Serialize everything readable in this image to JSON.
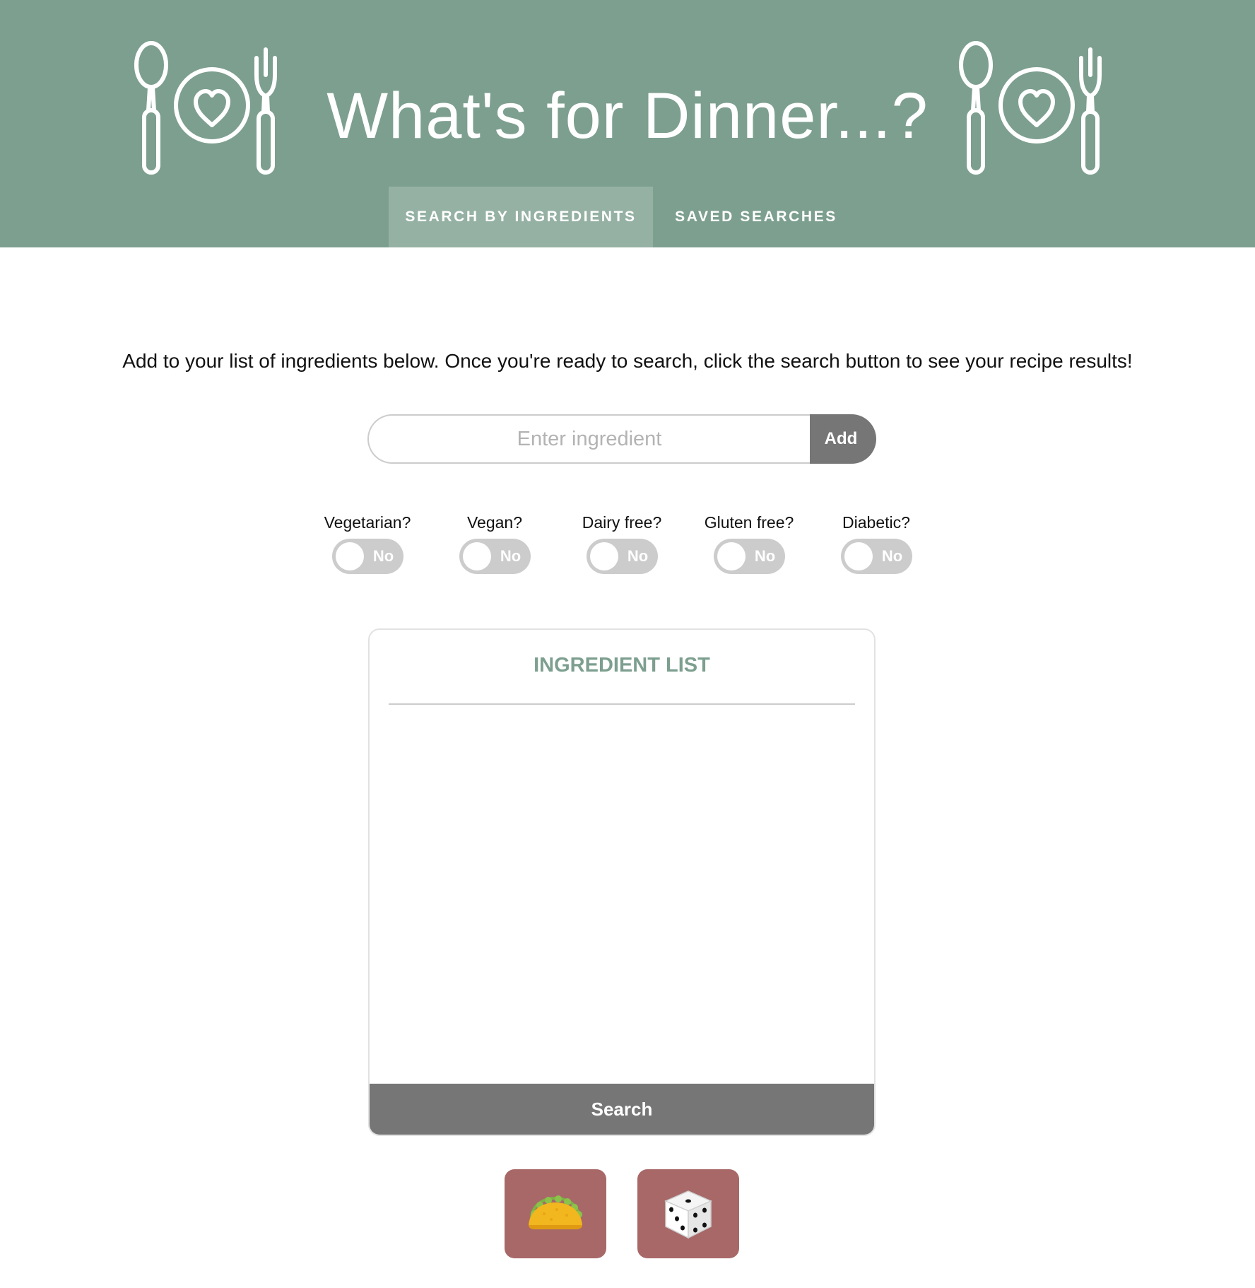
{
  "header": {
    "title": "What's for Dinner...?",
    "logo_icon": "spoon-plate-heart-fork-icon",
    "background_color": "#7d9f8f"
  },
  "nav": {
    "tabs": [
      {
        "label": "SEARCH BY INGREDIENTS",
        "active": true
      },
      {
        "label": "SAVED SEARCHES",
        "active": false
      }
    ]
  },
  "intro": {
    "text": "Add to your list of ingredients below. Once you're ready to search, click the search button to see your recipe results!"
  },
  "ingredient_form": {
    "placeholder": "Enter ingredient",
    "value": "",
    "add_label": "Add"
  },
  "filters": [
    {
      "label": "Vegetarian?",
      "state": "No"
    },
    {
      "label": "Vegan?",
      "state": "No"
    },
    {
      "label": "Dairy free?",
      "state": "No"
    },
    {
      "label": "Gluten free?",
      "state": "No"
    },
    {
      "label": "Diabetic?",
      "state": "No"
    }
  ],
  "ingredient_list": {
    "title": "INGREDIENT LIST",
    "items": [],
    "search_label": "Search"
  },
  "action_buttons": [
    {
      "icon": "taco-icon",
      "color": "#a86868"
    },
    {
      "icon": "dice-icon",
      "color": "#a86868"
    }
  ],
  "colors": {
    "accent": "#7d9f8f",
    "active_tab": "#95b1a4",
    "button_gray": "#767676",
    "action_button": "#a86868"
  }
}
